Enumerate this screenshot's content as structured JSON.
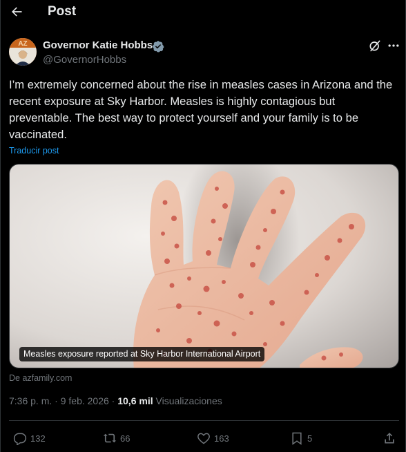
{
  "header": {
    "title": "Post",
    "back_icon": "arrow-left-icon"
  },
  "author": {
    "name": "Governor Katie Hobbs",
    "handle": "@GovernorHobbs",
    "verified": true,
    "avatar_text": "AZ"
  },
  "post": {
    "text": "I’m extremely concerned about the rise in measles cases in Arizona and the recent exposure at Sky Harbor. Measles is highly contagious but preventable. The best way to protect yourself and your family is to be vaccinated.",
    "translate_label": "Traducir post",
    "media_caption": "Measles exposure reported at Sky Harbor International Airport",
    "source": "De azfamily.com",
    "time": "7:36 p. m.",
    "separator": "·",
    "date": "9 feb. 2026",
    "views_count": "10,6 mil",
    "views_label": "Visualizaciones"
  },
  "actions": {
    "replies": "132",
    "reposts": "66",
    "likes": "163",
    "bookmarks": "5"
  },
  "colors": {
    "accent": "#1d9bf0",
    "muted": "#71767b",
    "text": "#e7e9ea",
    "background": "#000000",
    "border": "#2f3336"
  }
}
